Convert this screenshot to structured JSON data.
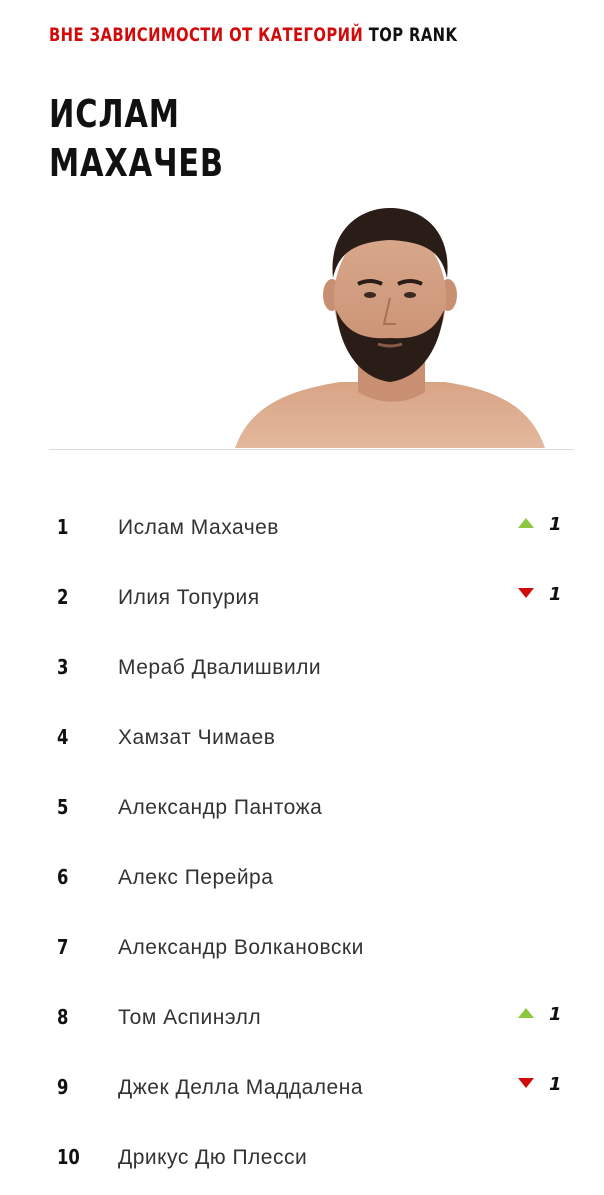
{
  "header": {
    "category": "ВНЕ ЗАВИСИМОСТИ ОТ КАТЕГОРИЙ",
    "rank_label": "TOP RANK"
  },
  "champion": {
    "first_name": "ИСЛАМ",
    "last_name": "МАХАЧЕВ"
  },
  "colors": {
    "accent_red": "#d20a0a",
    "up_green": "#8dc63f"
  },
  "rankings": [
    {
      "rank": "1",
      "name": "Ислам Махачев",
      "movement": "up",
      "change": "1"
    },
    {
      "rank": "2",
      "name": "Илия Топурия",
      "movement": "down",
      "change": "1"
    },
    {
      "rank": "3",
      "name": "Мераб Двалишвили",
      "movement": "none",
      "change": ""
    },
    {
      "rank": "4",
      "name": "Хамзат Чимаев",
      "movement": "none",
      "change": ""
    },
    {
      "rank": "5",
      "name": "Александр Пантожа",
      "movement": "none",
      "change": ""
    },
    {
      "rank": "6",
      "name": "Алекс Перейра",
      "movement": "none",
      "change": ""
    },
    {
      "rank": "7",
      "name": "Александр Волкановски",
      "movement": "none",
      "change": ""
    },
    {
      "rank": "8",
      "name": "Том Аспинэлл",
      "movement": "up",
      "change": "1"
    },
    {
      "rank": "9",
      "name": "Джек Делла Маддалена",
      "movement": "down",
      "change": "1"
    },
    {
      "rank": "10",
      "name": "Дрикус Дю Плесси",
      "movement": "none",
      "change": ""
    }
  ]
}
